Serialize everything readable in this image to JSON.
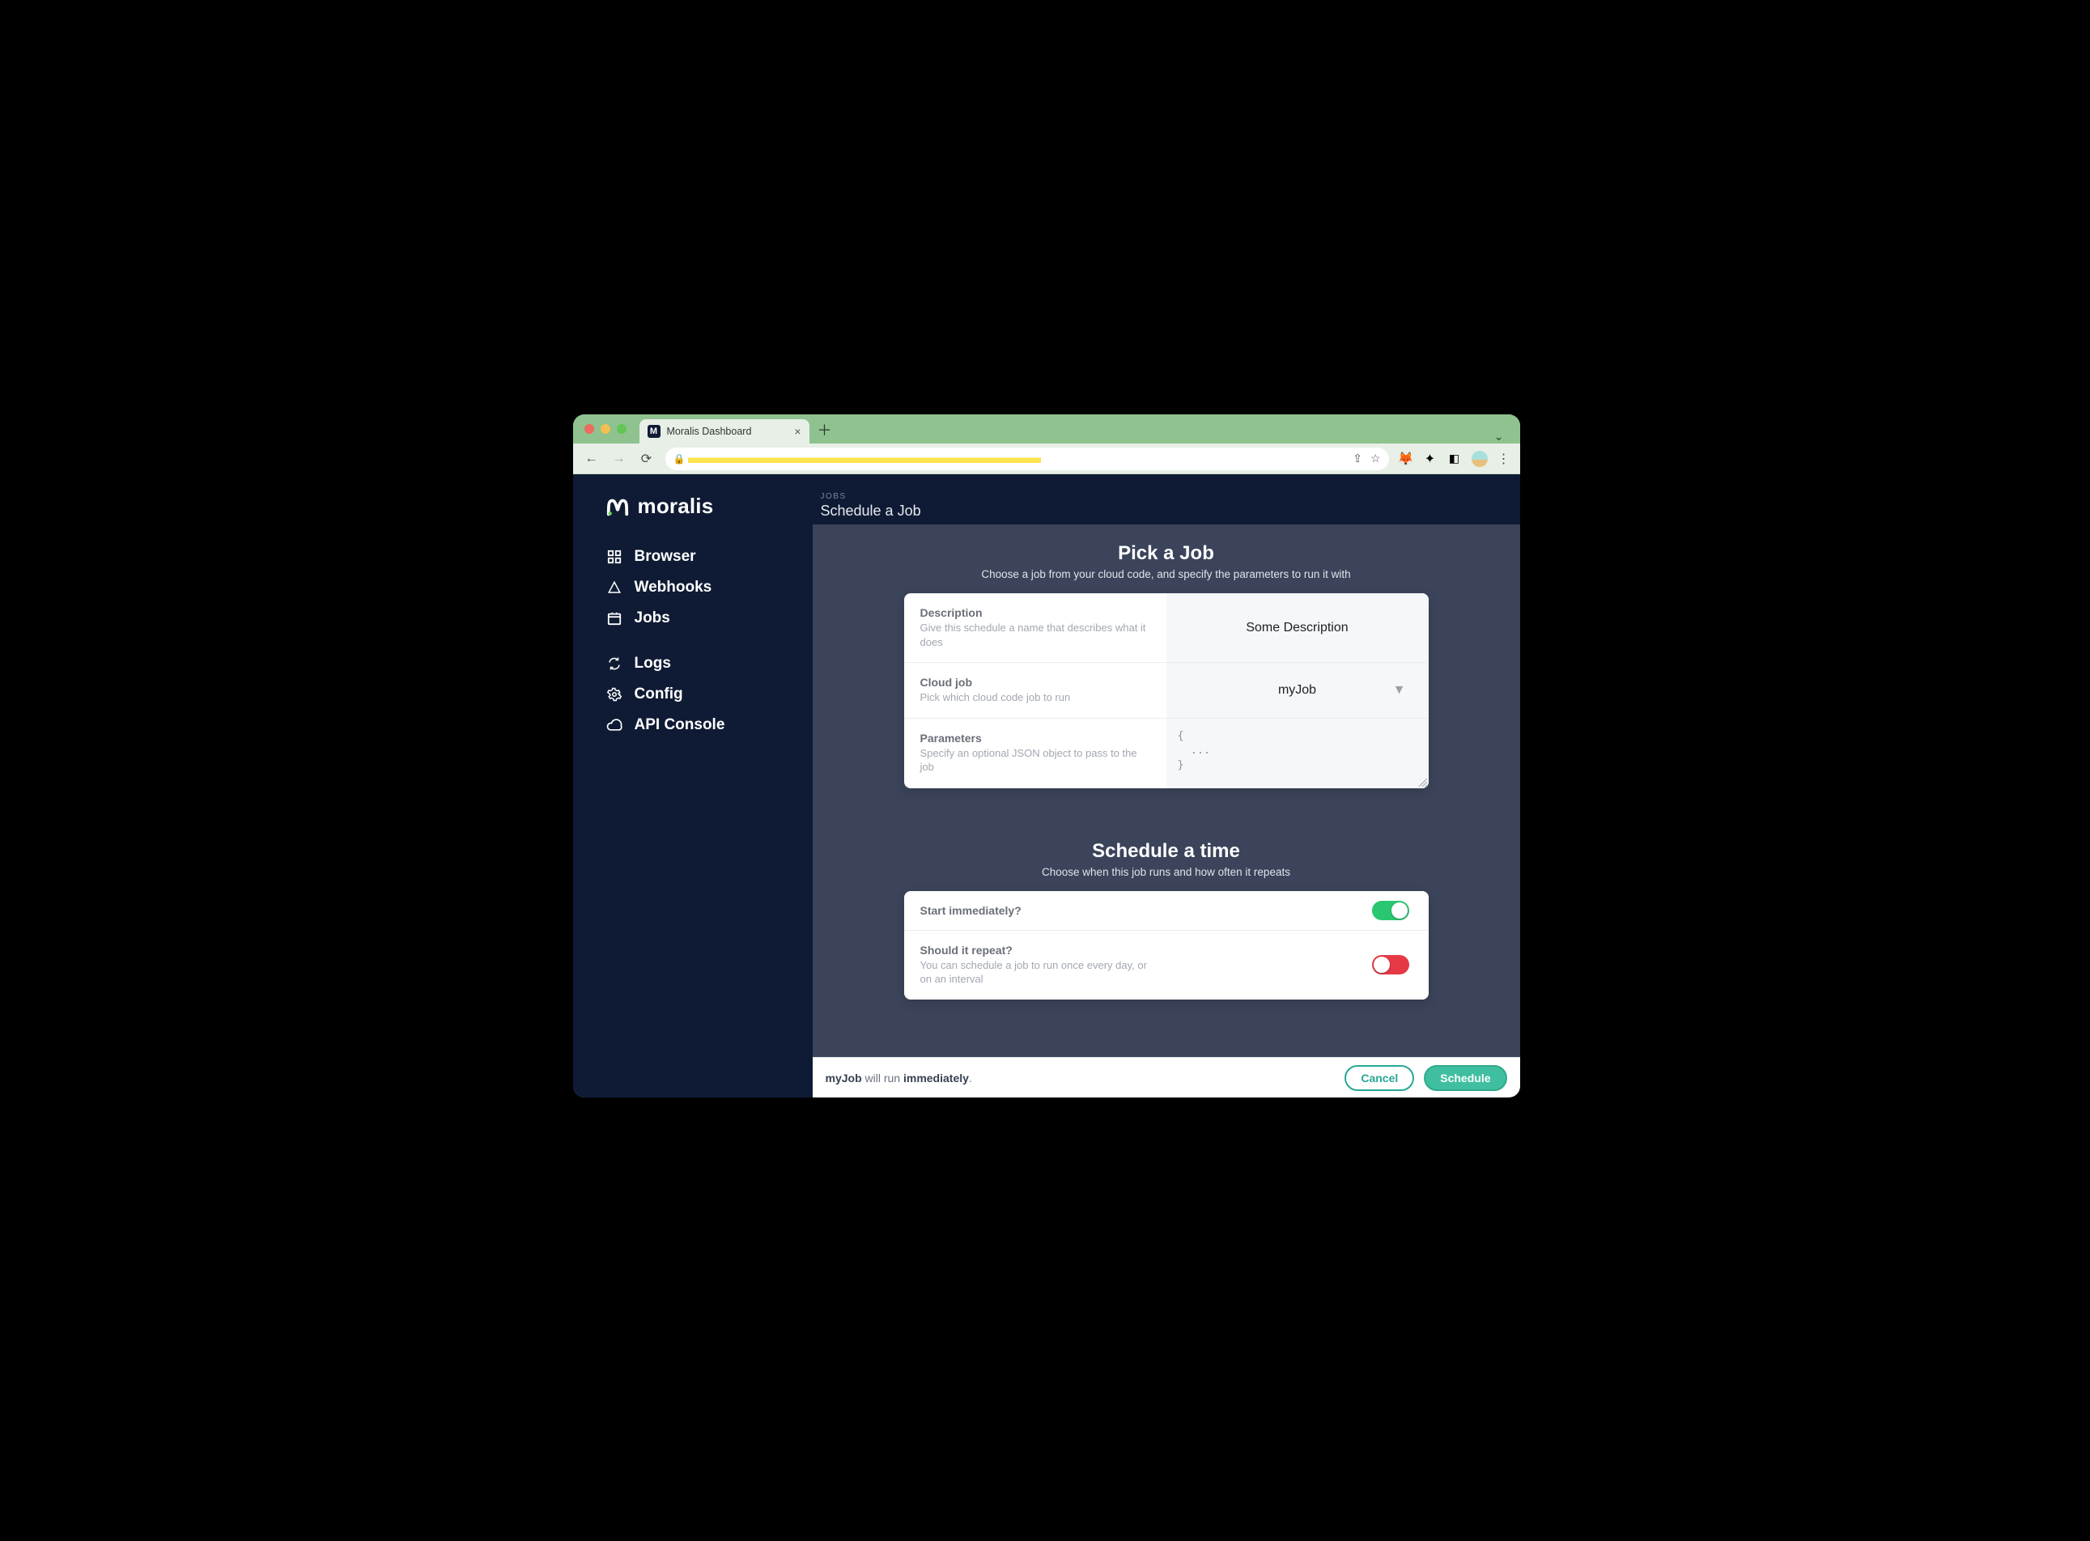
{
  "browser": {
    "tab_title": "Moralis Dashboard"
  },
  "brand": "moralis",
  "sidebar": {
    "items": [
      {
        "label": "Browser",
        "icon": "grid-icon"
      },
      {
        "label": "Webhooks",
        "icon": "webhook-icon"
      },
      {
        "label": "Jobs",
        "icon": "calendar-icon"
      }
    ],
    "items2": [
      {
        "label": "Logs",
        "icon": "sync-icon"
      },
      {
        "label": "Config",
        "icon": "gear-icon"
      },
      {
        "label": "API Console",
        "icon": "cloud-icon"
      }
    ]
  },
  "crumbs": {
    "eyebrow": "JOBS",
    "title": "Schedule a Job"
  },
  "pick": {
    "heading": "Pick a Job",
    "subtitle": "Choose a job from your cloud code, and specify the parameters to run it with",
    "description": {
      "label": "Description",
      "hint": "Give this schedule a name that describes what it does",
      "value": "Some Description"
    },
    "cloudjob": {
      "label": "Cloud job",
      "hint": "Pick which cloud code job to run",
      "value": "myJob"
    },
    "params": {
      "label": "Parameters",
      "hint": "Specify an optional JSON object to pass to the job",
      "value": "{\n  ...\n}"
    }
  },
  "time": {
    "heading": "Schedule a time",
    "subtitle": "Choose when this job runs and how often it repeats",
    "start": {
      "label": "Start immediately?",
      "on": true
    },
    "repeat": {
      "label": "Should it repeat?",
      "hint": "You can schedule a job to run once every day, or on an interval",
      "on": false
    }
  },
  "footer": {
    "job": "myJob",
    "mid": " will run ",
    "when": "immediately",
    "period": ".",
    "cancel": "Cancel",
    "schedule": "Schedule"
  }
}
